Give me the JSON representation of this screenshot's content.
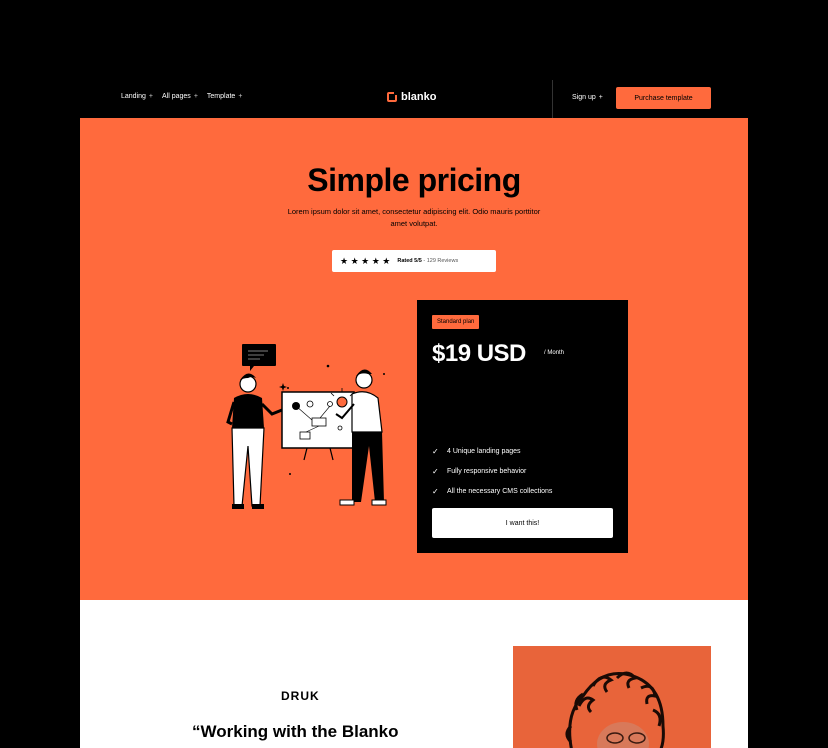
{
  "nav": {
    "links": [
      {
        "label": "Landing",
        "suffix": "+"
      },
      {
        "label": "All pages",
        "suffix": "+"
      },
      {
        "label": "Template",
        "suffix": "+"
      }
    ],
    "logo": "blanko",
    "signup": {
      "label": "Sign up",
      "suffix": "+"
    },
    "purchase": "Purchase template"
  },
  "hero": {
    "title": "Simple pricing",
    "subtitle": "Lorem ipsum dolor sit amet, consectetur adipiscing elit. Odio mauris porttitor amet volutpat.",
    "rating": {
      "stars": "★ ★ ★ ★ ★",
      "rated": "Rated 5/5",
      "reviews": " - 129 Reviews"
    }
  },
  "card": {
    "badge": "Standard plan",
    "price": "$19 USD",
    "period": "/ Month",
    "features": [
      "4 Unique landing pages",
      "Fully responsive behavior",
      "All the necessary CMS collections"
    ],
    "cta": "I want this!"
  },
  "testimonial": {
    "logo": "DRUK",
    "quote": "“Working with the Blanko"
  },
  "colors": {
    "accent": "#ff6a3d",
    "dark": "#000000",
    "light": "#ffffff"
  }
}
